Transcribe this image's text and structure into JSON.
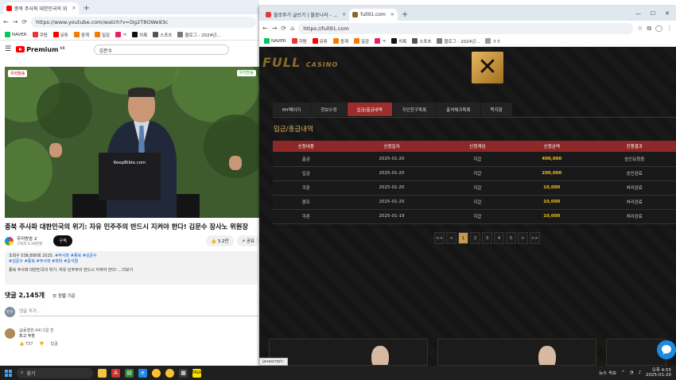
{
  "left_window": {
    "tab_title": "종북 주사파 대한민국의 위",
    "url": "https://www.youtube.com/watch?v=Dg2T8OWe93c",
    "bookmarks": [
      "NAVER",
      "쿠팡",
      "유튜",
      "중계",
      "일감",
      "ㅋ",
      "치록",
      "스포츠",
      "블로그 - 2024년..."
    ],
    "youtube": {
      "logo": "Premium",
      "logo_region": "KR",
      "search_value": "김문수",
      "video_badge_left": "우리방송",
      "video_badge_right": "우리방송",
      "laptop_label": "KeepBible.com",
      "title": "종북 주사파 대한민국의 위기: 자유 민주주의 반드시 지켜야 한다! 김문수 장사노 위원장",
      "channel_name": "우리방송 2",
      "subscribers": "구독자 5.59만명",
      "subscribe_label": "구독",
      "like_count": "3.2만",
      "share_label": "공유",
      "desc_stats": "조회수 538,890회  2025.",
      "desc_tags_1": "#주사파 #종북 #김문수",
      "desc_tags_2": "#김문수 #종북 #주사파 #좌파 #윤석열",
      "desc_text": "종북 주사파 대한민국의 위기: 자유 민주주의 반드시 지켜야 한다! ...더보기",
      "comments_count": "댓글 2,145개",
      "sort_label": "정렬 기준",
      "comment_placeholder": "댓글 추가...",
      "user_initials": "진우",
      "comment_user": "@동행한-ll4l 1일 전",
      "comment_text": "최고 주장",
      "comment_likes": "737",
      "reply_label": "답글"
    }
  },
  "right_window": {
    "tab1_title": "블로후기 글쓰기 | 블로나라 - ...",
    "tab2_title": "full91.com",
    "url": "https://full91.com",
    "bookmarks": [
      "NAVER",
      "쿠팡",
      "유튜",
      "중계",
      "일감",
      "ㅋ",
      "치록",
      "스포츠",
      "블로그 - 2024년...",
      "ㅎㅎ"
    ],
    "site": {
      "logo": "FULL",
      "logo_sub": "CASINO",
      "close_glyph": "✕",
      "nav": [
        "MY페이지",
        "정보수정",
        "입금/출금내역",
        "지인친구목록",
        "출석체크목록",
        "쪽지함"
      ],
      "active_nav": 2,
      "section_title": "입금/출금내역",
      "table_headers": [
        "신청내용",
        "신청일자",
        "신청게임",
        "신청금액",
        "진행결과"
      ],
      "rows": [
        [
          "출금",
          "2025-01-20",
          "지갑",
          "400,000",
          "승인요청중"
        ],
        [
          "입금",
          "2025-01-20",
          "지갑",
          "200,000",
          "승인완료"
        ],
        [
          "쿠폰",
          "2025-01-20",
          "지갑",
          "10,000",
          "처리완료"
        ],
        [
          "콤프",
          "2025-01-20",
          "지갑",
          "10,000",
          "처리완료"
        ],
        [
          "쿠폰",
          "2025-01-19",
          "지갑",
          "10,000",
          "처리완료"
        ]
      ],
      "pager": [
        "<<",
        "<",
        "1",
        "2",
        "3",
        "4",
        "5",
        ">",
        ">>"
      ],
      "current_page": "1",
      "status_url": "javascript:;"
    }
  },
  "taskbar": {
    "search_placeholder": "찾기",
    "news_label": "뉴스 속보",
    "time": "오후 4:55",
    "date": "2025-01-20"
  },
  "colors": {
    "youtube_red": "#ff0000",
    "casino_red": "#8e2727",
    "casino_gold": "#c79a4a",
    "amount_yellow": "#f0c020"
  }
}
